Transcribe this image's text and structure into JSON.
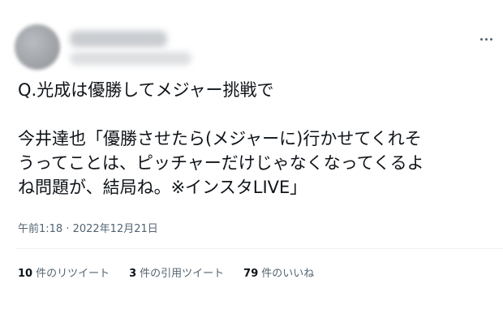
{
  "tweet": {
    "lines": [
      "Q.光成は優勝してメジャー挑戦で",
      "今井達也「優勝させたら(メジャーに)行かせてくれそ",
      "うってことは、ピッチャーだけじゃなくなってくるよ",
      "ね問題が、結局ね。※インスタLIVE」"
    ],
    "timestamp": "午前1:18 · 2022年12月21日",
    "stats": {
      "retweets_count": "10",
      "retweets_label": "件のリツイート",
      "quotes_count": "3",
      "quotes_label": "件の引用ツイート",
      "likes_count": "79",
      "likes_label": "件のいいね"
    }
  },
  "icons": {
    "more": "more-horizontal-icon"
  },
  "colors": {
    "text": "#0f1419",
    "secondary": "#536471",
    "divider": "#eff3f4"
  }
}
